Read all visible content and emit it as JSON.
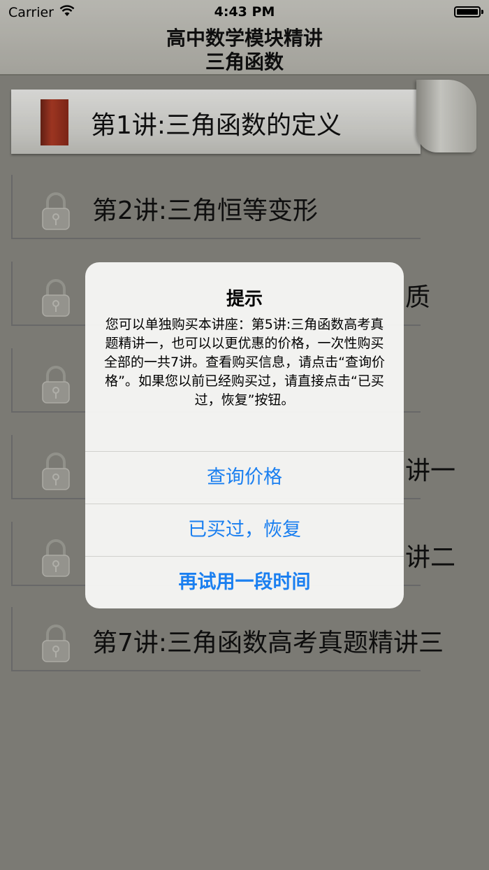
{
  "status_bar": {
    "carrier": "Carrier",
    "time": "4:43 PM"
  },
  "nav": {
    "title_line1": "高中数学模块精讲",
    "title_line2": "三角函数"
  },
  "lectures": [
    {
      "label": "第1讲:三角函数的定义",
      "locked": false
    },
    {
      "label": "第2讲:三角恒等变形",
      "locked": true
    },
    {
      "label": "质",
      "locked": true
    },
    {
      "label": "",
      "locked": true
    },
    {
      "label": "讲一",
      "locked": true
    },
    {
      "label": "讲二",
      "locked": true
    },
    {
      "label": "第7讲:三角函数高考真题精讲三",
      "locked": true
    }
  ],
  "alert": {
    "title": "提示",
    "message": "您可以单独购买本讲座：第5讲:三角函数高考真题精讲一，也可以以更优惠的价格，一次性购买全部的一共7讲。查看购买信息，请点击“查询价格”。如果您以前已经购买过，请直接点击“已买过，恢复”按钮。",
    "buttons": [
      "查询价格",
      "已买过，恢复",
      "再试用一段时间"
    ]
  },
  "colors": {
    "accent": "#1a7ff0",
    "bookmark": "#b23d26",
    "background": "#8c8b84"
  }
}
